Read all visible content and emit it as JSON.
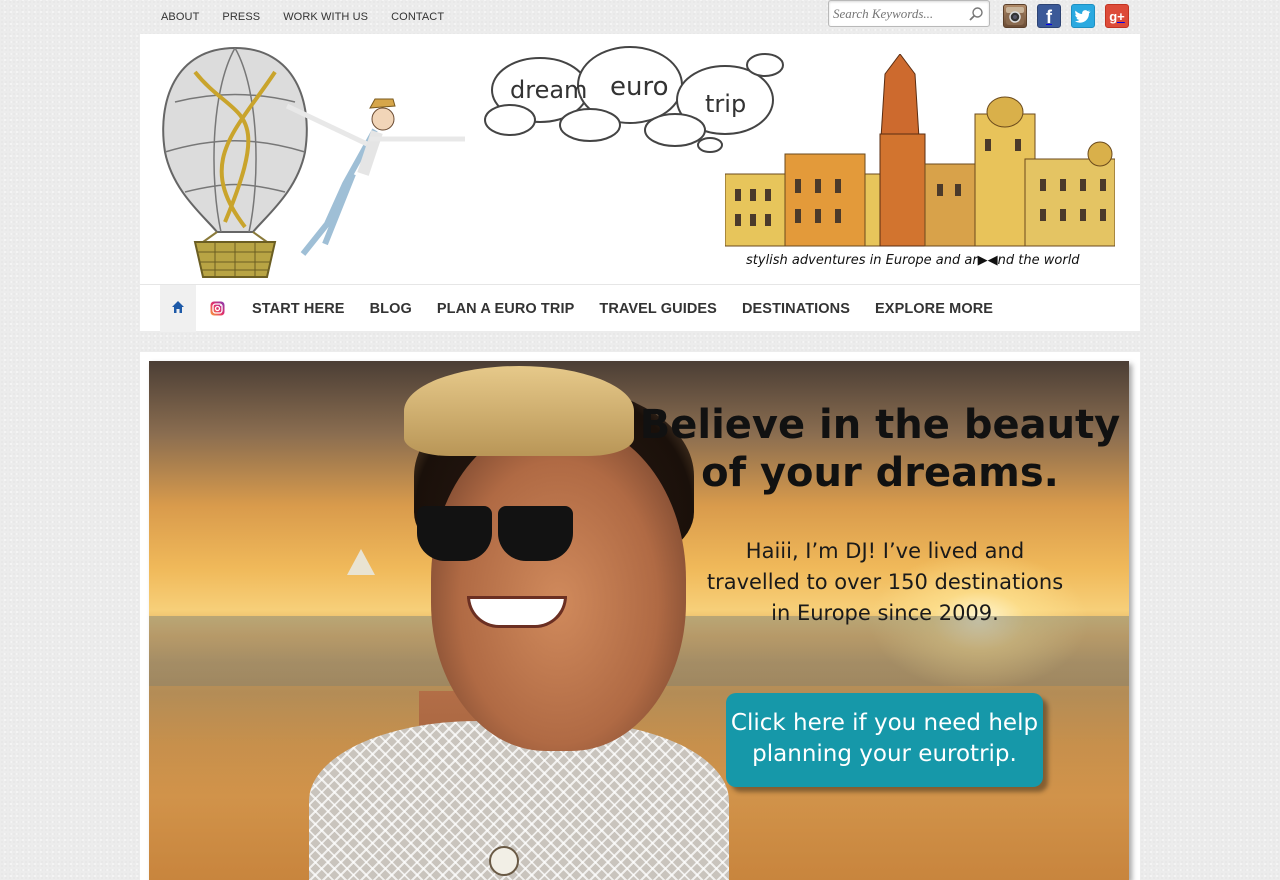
{
  "top_nav": {
    "links": [
      "ABOUT",
      "PRESS",
      "WORK WITH US",
      "CONTACT"
    ]
  },
  "search": {
    "placeholder": "Search Keywords...",
    "icon": "search-icon"
  },
  "social": {
    "icons": [
      "instagram-icon",
      "facebook-icon",
      "twitter-icon",
      "google-plus-icon"
    ],
    "facebook_glyph": "f",
    "google_plus_glyph": "g+"
  },
  "header": {
    "logo_words": [
      "dream",
      "euro",
      "trip"
    ],
    "tagline": "stylish adventures in Europe and ar▶◀nd the world"
  },
  "main_nav": {
    "items": [
      "START HERE",
      "BLOG",
      "PLAN A EURO TRIP",
      "TRAVEL GUIDES",
      "DESTINATIONS",
      "EXPLORE MORE"
    ]
  },
  "hero": {
    "headline_line1": "Believe in the beauty",
    "headline_line2": "of your dreams.",
    "intro_line1": "Haiii, I’m DJ! I’ve lived and",
    "intro_line2": "travelled to over 150 destinations",
    "intro_line3": "in Europe since 2009.",
    "cta_line1": "Click here if you need help",
    "cta_line2": "planning your eurotrip."
  },
  "colors": {
    "cta": "#1698a9",
    "facebook": "#3b5998",
    "twitter": "#2aa9e0",
    "google_plus": "#dd4b39",
    "home_icon": "#1e5aa8"
  }
}
